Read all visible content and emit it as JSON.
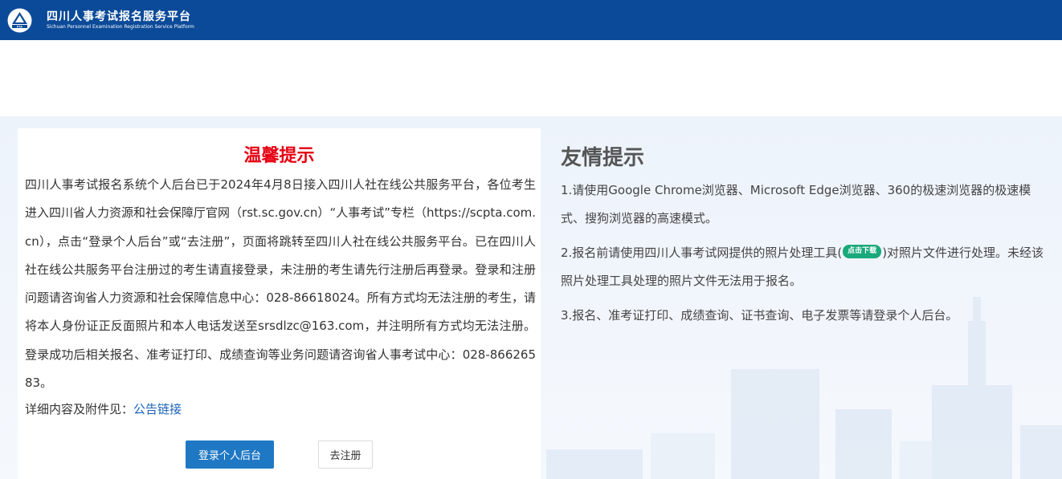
{
  "header": {
    "title": "四川人事考试报名服务平台",
    "subtitle": "Sichuan Personnel Examination Registration Service Platform",
    "logo_text": "PTA",
    "bg_color": "#0b4a98"
  },
  "notice": {
    "title": "温馨提示",
    "body": "四川人事考试报名系统个人后台已于2024年4月8日接入四川人社在线公共服务平台，各位考生进入四川省人力资源和社会保障厅官网（rst.sc.gov.cn）“人事考试”专栏（https://scpta.com.cn），点击“登录个人后台”或“去注册”，页面将跳转至四川人社在线公共服务平台。已在四川人社在线公共服务平台注册过的考生请直接登录，未注册的考生请先行注册后再登录。登录和注册问题请咨询省人力资源和社会保障信息中心：028-86618024。所有方式均无法注册的考生，请将本人身份证正反面照片和本人电话发送至srsdlzc@163.com，并注明所有方式均无法注册。登录成功后相关报名、准考证打印、成绩查询等业务问题请咨询省人事考试中心：028-86626583。",
    "detail_prefix": "详细内容及附件见：",
    "detail_link": "公告链接",
    "login_button": "登录个人后台",
    "register_button": "去注册",
    "title_color": "#e60012",
    "button_color": "#1f78c4"
  },
  "tips": {
    "title": "友情提示",
    "tip1": "1.请使用Google Chrome浏览器、Microsoft Edge浏览器、360的极速浏览器的极速模式、搜狗浏览器的高速模式。",
    "tip2_before": "2.报名前请使用四川人事考试网提供的照片处理工具(",
    "tip2_badge": "点击下载",
    "tip2_after": ")对照片文件进行处理。未经该照片处理工具处理的照片文件无法用于报名。",
    "tip3": "3.报名、准考证打印、成绩查询、证书查询、电子发票等请登录个人后台。",
    "badge_color": "#1aa97a"
  }
}
